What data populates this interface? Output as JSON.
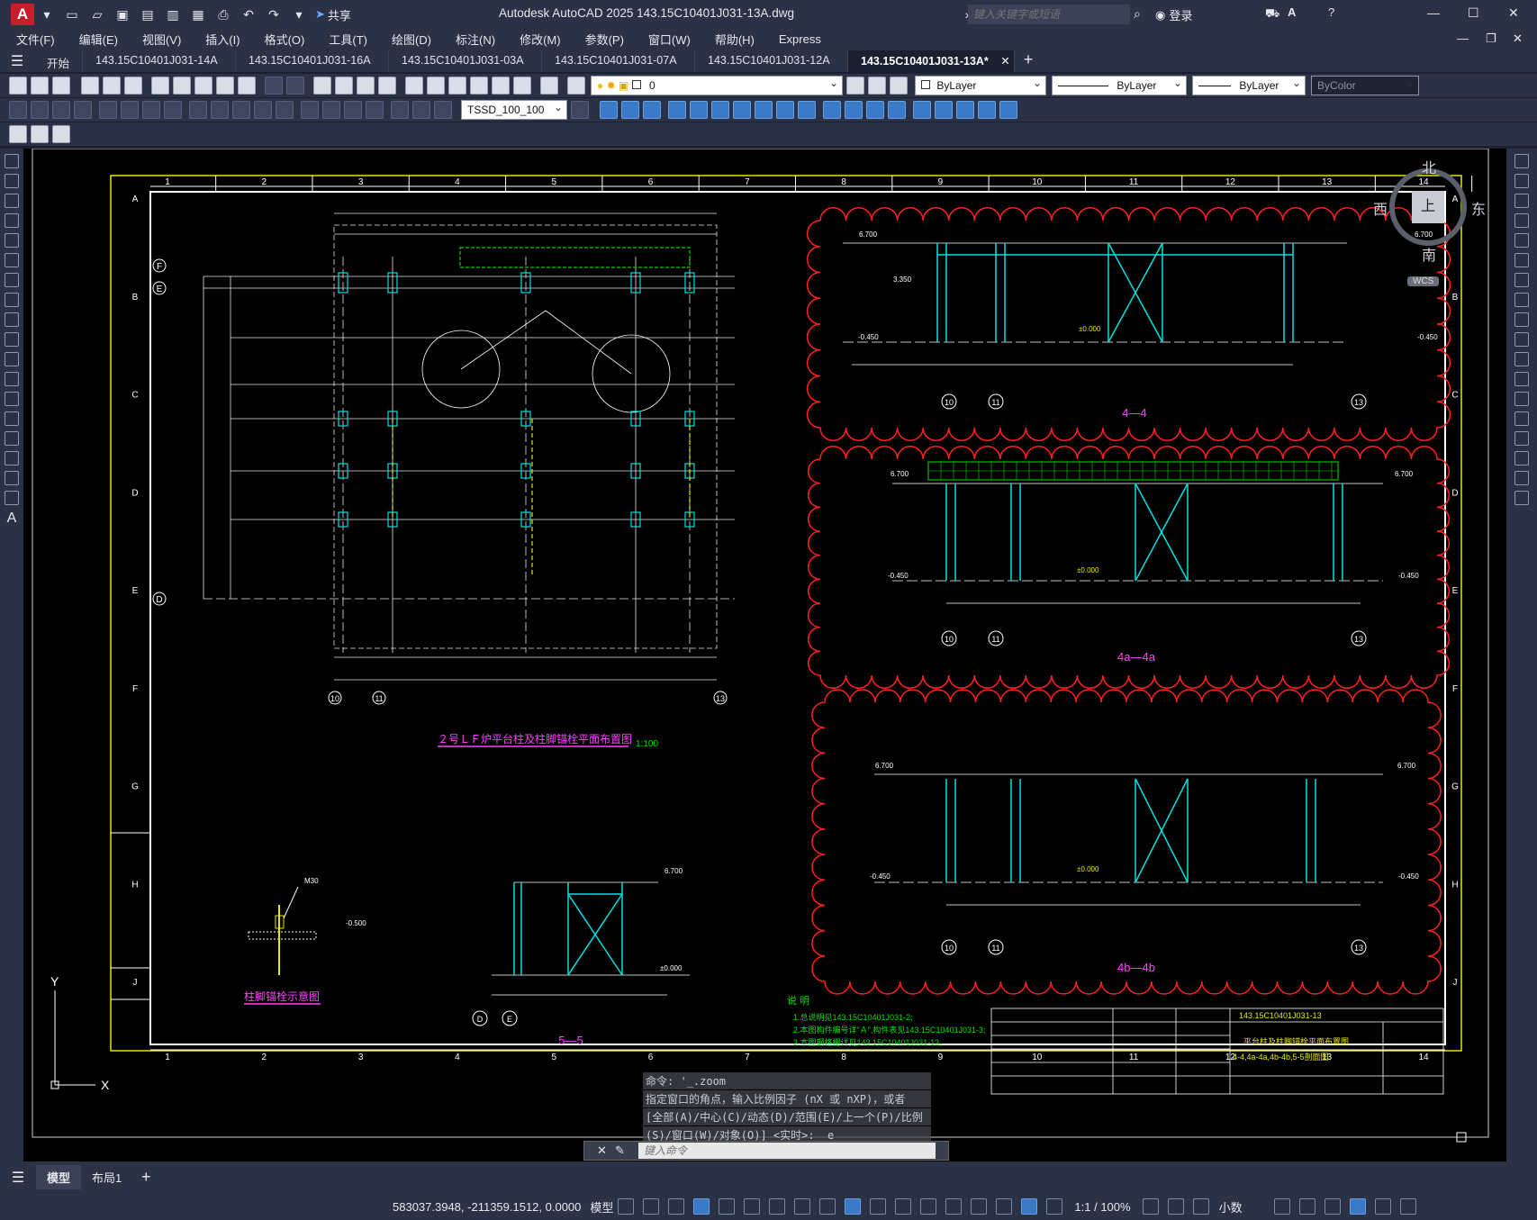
{
  "app": {
    "title": "Autodesk AutoCAD 2025    143.15C10401J031-13A.dwg",
    "share_label": "共享",
    "search_placeholder": "键入关键字或短语",
    "login_label": "登录"
  },
  "menu": [
    "文件(F)",
    "编辑(E)",
    "视图(V)",
    "插入(I)",
    "格式(O)",
    "工具(T)",
    "绘图(D)",
    "标注(N)",
    "修改(M)",
    "参数(P)",
    "窗口(W)",
    "帮助(H)",
    "Express"
  ],
  "tabs": [
    {
      "label": "开始"
    },
    {
      "label": "143.15C10401J031-14A"
    },
    {
      "label": "143.15C10401J031-16A"
    },
    {
      "label": "143.15C10401J031-03A"
    },
    {
      "label": "143.15C10401J031-07A"
    },
    {
      "label": "143.15C10401J031-12A"
    },
    {
      "label": "143.15C10401J031-13A*"
    }
  ],
  "layers": {
    "current_layer": "0",
    "color": "ByLayer",
    "linetype": "ByLayer",
    "lineweight": "ByLayer",
    "plotstyle": "ByColor",
    "dimstyle": "TSSD_100_100"
  },
  "viewcube": {
    "north": "北",
    "south": "南",
    "east": "东",
    "west": "西",
    "face": "上",
    "wcs": "WCS"
  },
  "drawing": {
    "col_labels": [
      "1",
      "2",
      "3",
      "4",
      "5",
      "6",
      "7",
      "8",
      "9",
      "10",
      "11",
      "12",
      "13",
      "14"
    ],
    "row_labels": [
      "A",
      "B",
      "C",
      "D",
      "E",
      "F",
      "G",
      "H",
      "J"
    ],
    "plan_title": "２号ＬＦ炉平台柱及柱脚锚栓平面布置图",
    "plan_scale": "1:100",
    "section_44": "4—4",
    "section_4a": "4a—4a",
    "section_4b": "4b—4b",
    "section_55": "5—5",
    "bolt_title": "柱脚锚栓示意图",
    "bolt_label": "M30",
    "notes_title": "说 明",
    "notes": [
      "1.总说明见143.15C10401J031-2;",
      "2.本图构件编号详\"Ａ\",构件表见143.15C10401J031-3;",
      "3.本图钢格栅详见143.15C10401J031-13。"
    ],
    "title_block_number": "143.15C10401J031-13",
    "title_block_name1": "平台柱及柱脚锚栓平面布置图",
    "title_block_name2": "4-4,4a-4a,4b-4b,5-5剖面图",
    "axis_10": "10",
    "axis_11": "11",
    "axis_13": "13",
    "axis_D": "D",
    "axis_E": "E",
    "axis_F": "F",
    "elev_6700": "6.700",
    "elev_m0450": "-0.450",
    "elev_0000": "±0.000",
    "elev_3350": "3.350",
    "elev_m0500": "-0.500"
  },
  "command": {
    "history": [
      "命令: '_.zoom",
      "指定窗口的角点，输入比例因子 (nX 或 nXP)，或者",
      "[全部(A)/中心(C)/动态(D)/范围(E)/上一个(P)/比例",
      "(S)/窗口(W)/对象(O)] <实时>: _e"
    ],
    "placeholder": "键入命令"
  },
  "layout_tabs": [
    {
      "label": "模型"
    },
    {
      "label": "布局1"
    }
  ],
  "status": {
    "coords": "583037.3948, -211359.1512, 0.0000",
    "model_label": "模型",
    "scale": "1:1 / 100%",
    "units": "小数"
  }
}
